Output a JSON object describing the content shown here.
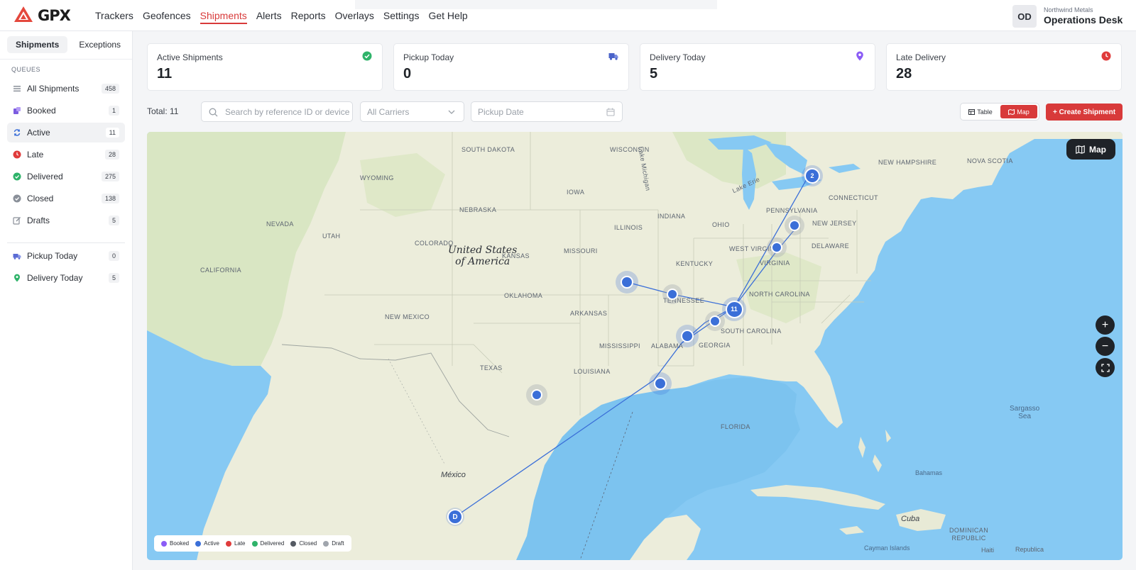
{
  "app": {
    "logo_text": "GPX"
  },
  "nav": {
    "items": [
      "Trackers",
      "Geofences",
      "Shipments",
      "Alerts",
      "Reports",
      "Overlays",
      "Settings",
      "Get Help"
    ],
    "active": "Shipments"
  },
  "account": {
    "initials": "OD",
    "org": "Northwind Metals",
    "name": "Operations Desk"
  },
  "sidebar": {
    "tabs": [
      {
        "label": "Shipments",
        "active": true
      },
      {
        "label": "Exceptions",
        "active": false
      }
    ],
    "queues_title": "QUEUES",
    "queues": [
      {
        "label": "All Shipments",
        "count": "458",
        "icon": "list-icon"
      },
      {
        "label": "Booked",
        "count": "1",
        "icon": "booked-icon"
      },
      {
        "label": "Active",
        "count": "11",
        "icon": "refresh-icon",
        "active": true
      },
      {
        "label": "Late",
        "count": "28",
        "icon": "late-clock-icon"
      },
      {
        "label": "Delivered",
        "count": "275",
        "icon": "check-circle-icon"
      },
      {
        "label": "Closed",
        "count": "138",
        "icon": "closed-check-icon"
      },
      {
        "label": "Drafts",
        "count": "5",
        "icon": "edit-icon"
      }
    ],
    "shortcuts": [
      {
        "label": "Pickup Today",
        "count": "0",
        "icon": "truck-icon"
      },
      {
        "label": "Delivery Today",
        "count": "5",
        "icon": "pin-icon"
      }
    ]
  },
  "stats": [
    {
      "label": "Active Shipments",
      "value": "11",
      "icon": "check-circle-icon",
      "color": "#2fb36a"
    },
    {
      "label": "Pickup Today",
      "value": "0",
      "icon": "truck-icon",
      "color": "#4a63c9"
    },
    {
      "label": "Delivery Today",
      "value": "5",
      "icon": "pin-icon",
      "color": "#8b5cf6"
    },
    {
      "label": "Late Delivery",
      "value": "28",
      "icon": "clock-icon",
      "color": "#e03b3b"
    }
  ],
  "filters": {
    "total": "Total: 11",
    "search_placeholder": "Search by reference ID or device",
    "carrier_value": "All Carriers",
    "pickup_placeholder": "Pickup Date"
  },
  "view_toggle": {
    "table": "Table",
    "map": "Map",
    "active": "Map"
  },
  "create_button": "+ Create Shipment",
  "map": {
    "control_label": "Map",
    "labels": {
      "country_us": "United States\nof America",
      "mexico": "México",
      "cuba": "Cuba",
      "bahamas": "Bahamas",
      "sargasso": "Sargasso\nSea",
      "cayman": "Cayman Islands",
      "dominican": "DOMINICAN\nREPUBLIC",
      "republica": "Republica",
      "haiti": "Haiti",
      "states": [
        "SOUTH DAKOTA",
        "WYOMING",
        "NEBRASKA",
        "IOWA",
        "WISCONSIN",
        "ILLINOIS",
        "INDIANA",
        "OHIO",
        "PENNSYLVANIA",
        "NEW JERSEY",
        "NEW HAMPSHIRE",
        "NOVA SCOTIA",
        "CONNECTICUT",
        "DELAWARE",
        "WEST VIRGINIA",
        "VIRGINIA",
        "KENTUCKY",
        "TENNESSEE",
        "NORTH CAROLINA",
        "SOUTH CAROLINA",
        "GEORGIA",
        "ALABAMA",
        "MISSISSIPPI",
        "LOUISIANA",
        "ARKANSAS",
        "OKLAHOMA",
        "TEXAS",
        "NEW MEXICO",
        "COLORADO",
        "UTAH",
        "NEVADA",
        "CALIFORNIA",
        "MISSOURI",
        "KANSAS",
        "FLORIDA",
        "Lake Michigan",
        "Lake Erie"
      ]
    },
    "markers": [
      {
        "label": "2"
      },
      {
        "label": "11"
      },
      {
        "label": "D"
      }
    ],
    "legend": [
      {
        "label": "Booked",
        "color": "#8b5cf6"
      },
      {
        "label": "Active",
        "color": "#3b6fd8"
      },
      {
        "label": "Late",
        "color": "#e03b3b"
      },
      {
        "label": "Delivered",
        "color": "#2fb36a"
      },
      {
        "label": "Closed",
        "color": "#555a63"
      },
      {
        "label": "Draft",
        "color": "#a0a5ad"
      }
    ]
  },
  "colors": {
    "accent": "#d83a3a",
    "active_marker": "#3b6fd8",
    "water": "#86c9f3",
    "land": "#eceddb"
  }
}
